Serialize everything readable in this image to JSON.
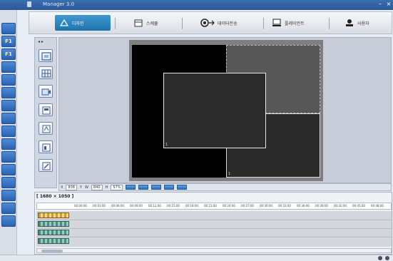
{
  "app": {
    "title": "Manager 3.0"
  },
  "window_controls": {
    "minimize": "–",
    "close": "×"
  },
  "left_strip": [
    "",
    "F1",
    "F1",
    "",
    "",
    "",
    "",
    "",
    "",
    "",
    "",
    "",
    "",
    "",
    "",
    ""
  ],
  "ribbon": {
    "tabs": [
      {
        "label": "디자인",
        "icon": "design-icon",
        "active": true
      },
      {
        "label": "스케쥴",
        "icon": "calendar-icon",
        "active": false
      },
      {
        "label": "데이터전송",
        "icon": "data-transfer-icon",
        "active": false
      },
      {
        "label": "플레이언트",
        "icon": "client-icon",
        "active": false
      },
      {
        "label": "사용자",
        "icon": "user-icon",
        "active": false
      }
    ]
  },
  "tool_panel": {
    "header": "◂ ▸"
  },
  "canvas": {
    "zones": [
      {
        "label": "",
        "color": "#000000"
      },
      {
        "label": "",
        "color": "#575757"
      },
      {
        "label": "1",
        "color": "#2c2c2c"
      },
      {
        "label": "1",
        "color": "#2a2a2a"
      }
    ]
  },
  "status": {
    "x_label": "X",
    "x_value": "838",
    "y_label": "Y",
    "w_label": "W",
    "w_value": "840",
    "h_label": "H",
    "zoom": "57%"
  },
  "timeline": {
    "resolution": "[ 1680 × 1050 ]",
    "ticks": [
      "00:00:00",
      "00:03:00",
      "00:06:00",
      "00:09:00",
      "00:12:00",
      "00:15:00",
      "00:18:00",
      "00:21:00",
      "00:24:00",
      "00:27:00",
      "00:30:00",
      "00:33:00",
      "00:36:00",
      "00:39:00",
      "00:42:00",
      "00:45:00",
      "00:48:00"
    ]
  }
}
